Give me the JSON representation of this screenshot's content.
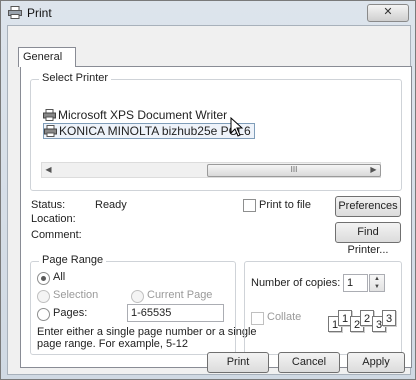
{
  "window": {
    "title": "Print",
    "close_symbol": "✕"
  },
  "tabs": [
    {
      "label": "General"
    }
  ],
  "select_printer": {
    "legend": "Select Printer",
    "printers": [
      {
        "name": "Microsoft XPS Document Writer",
        "selected": false
      },
      {
        "name": "KONICA MINOLTA bizhub25e PCL6",
        "selected": true
      }
    ],
    "scroll_thumb_grip": "III"
  },
  "status": {
    "status_label": "Status:",
    "status_value": "Ready",
    "location_label": "Location:",
    "comment_label": "Comment:",
    "print_to_file_label": "Print to file",
    "print_to_file_checked": false,
    "preferences_label": "Preferences",
    "find_printer_label": "Find Printer..."
  },
  "page_range": {
    "legend": "Page Range",
    "all_label": "All",
    "selection_label": "Selection",
    "current_page_label": "Current Page",
    "pages_label": "Pages:",
    "pages_value": "1-65535",
    "selected_option": "All",
    "help_text_line1": "Enter either a single page number or a single",
    "help_text_line2": "page range.  For example, 5-12"
  },
  "copies": {
    "number_of_copies_label": "Number of copies:",
    "number_of_copies_value": "1",
    "collate_label": "Collate",
    "collate_checked": false,
    "collate_pages": [
      "1",
      "1",
      "2",
      "2",
      "3",
      "3"
    ]
  },
  "footer": {
    "print_label": "Print",
    "cancel_label": "Cancel",
    "apply_label": "Apply"
  },
  "colors": {
    "title_bg": "#d6dee8",
    "selection": "#eef3fa"
  }
}
